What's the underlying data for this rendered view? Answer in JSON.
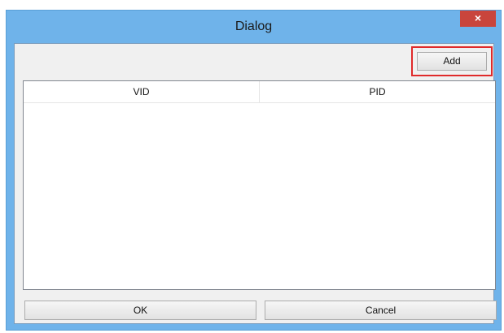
{
  "window": {
    "title": "Dialog",
    "close_glyph": "×"
  },
  "toolbar": {
    "add_label": "Add"
  },
  "table": {
    "columns": [
      "VID",
      "PID"
    ],
    "rows": []
  },
  "footer": {
    "ok_label": "OK",
    "cancel_label": "Cancel"
  },
  "colors": {
    "title_bar": "#6fb3ea",
    "close_button": "#c9453c",
    "highlight": "#e02a2a",
    "client_bg": "#f0f0f0"
  }
}
